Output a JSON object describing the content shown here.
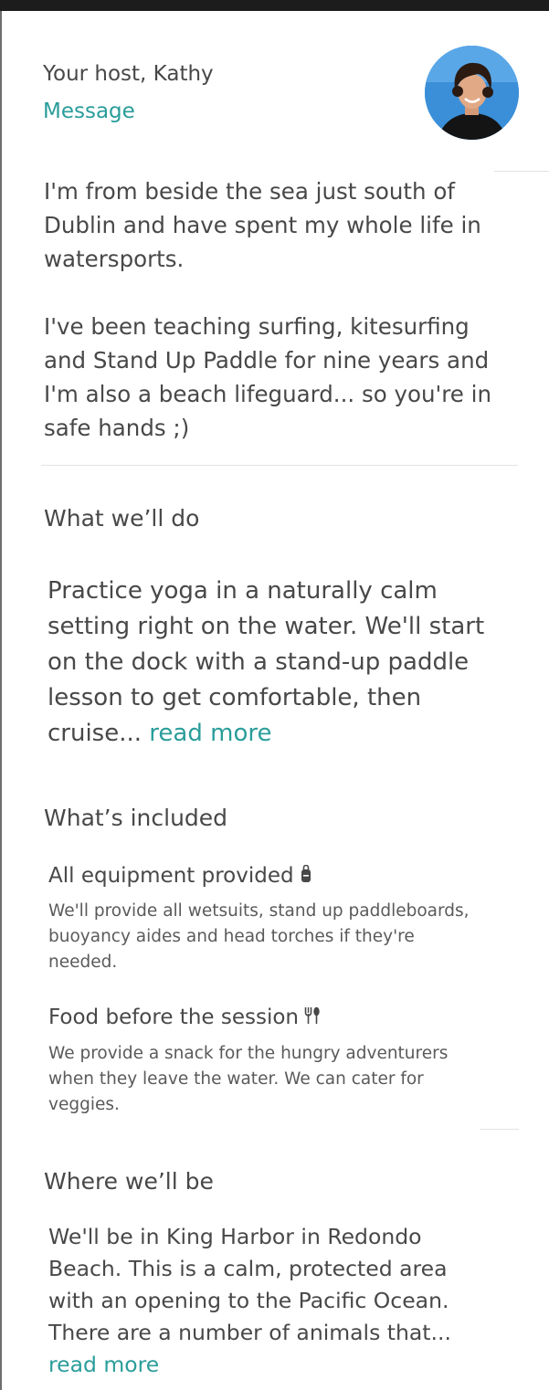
{
  "host": {
    "title": "Your host, Kathy",
    "message_label": "Message",
    "avatar_icon": "host-avatar-photo"
  },
  "bio": {
    "paragraph_1": "I'm from beside the sea just south of Dublin and have spent my whole life in watersports.",
    "paragraph_2": "I've been teaching surfing, kitesurfing and Stand Up Paddle for nine years and I'm also a beach lifeguard... so you're in safe hands ;)"
  },
  "what_we_do": {
    "heading": "What we’ll do",
    "text": "Practice yoga in a naturally calm setting right on the water. We'll start on the dock with a stand-up paddle lesson to get comfortable, then cruise...",
    "read_more": "read more"
  },
  "included": {
    "heading": "What’s included",
    "items": [
      {
        "title": "All equipment provided",
        "icon": "backpack-icon",
        "description": "We'll provide all wetsuits, stand up paddleboards, buoyancy aides and head torches if they're needed."
      },
      {
        "title": "Food before the session",
        "icon": "fork-knife-icon",
        "description": "We provide a snack for the hungry adventurers when they leave the water. We can cater for veggies."
      }
    ]
  },
  "where": {
    "heading": "Where we’ll be",
    "text": "We'll be in King Harbor in Redondo Beach. This is a calm, protected area with an opening to the Pacific Ocean. There are a number of animals that...",
    "read_more": "read more"
  },
  "colors": {
    "text": "#484848",
    "accent_teal": "#2a9d9a",
    "divider": "#e4e4e4",
    "top_bar": "#1c1c1c"
  }
}
